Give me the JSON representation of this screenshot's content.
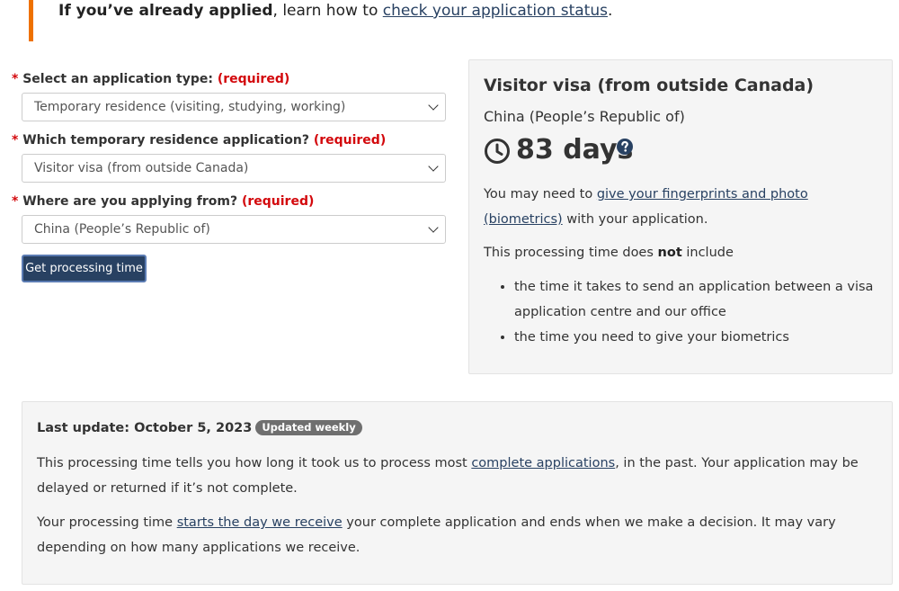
{
  "alert": {
    "bold": "If you’ve already applied",
    "text": ", learn how to ",
    "link": "check your application status",
    "end": "."
  },
  "form": {
    "required_star": "*",
    "required_text": "(required)",
    "fields": [
      {
        "label": "Select an application type:",
        "value": "Temporary residence (visiting, studying, working)"
      },
      {
        "label": "Which temporary residence application?",
        "value": "Visitor visa (from outside Canada)"
      },
      {
        "label": "Where are you applying from?",
        "value": "China (People’s Republic of)"
      }
    ],
    "submit_label": "Get processing time"
  },
  "result": {
    "title": "Visitor visa (from outside Canada)",
    "country": "China (People’s Republic of)",
    "days": "83 days",
    "biometrics_pre": "You may need to ",
    "biometrics_link": "give your fingerprints and photo (biometrics)",
    "biometrics_post": " with your application.",
    "exclude_pre": "This processing time does ",
    "exclude_bold": "not",
    "exclude_post": " include",
    "bullets": [
      "the time it takes to send an application between a visa application centre and our office",
      "the time you need to give your biometrics"
    ]
  },
  "info": {
    "last_update": "Last update: October 5, 2023",
    "badge": "Updated weekly",
    "p1_pre": "This processing time tells you how long it took us to process most ",
    "p1_link": "complete applications",
    "p1_post": ", in the past. Your application may be delayed or returned if it’s not complete.",
    "p2_pre": "Your processing time ",
    "p2_link": "starts the day we receive",
    "p2_post": " your complete application and ends when we make a decision. It may vary depending on how many applications we receive."
  },
  "colors": {
    "accent_orange": "#ee7100",
    "required_red": "#d3080c",
    "button_blue": "#284162",
    "link_blue": "#284162",
    "panel_bg": "#f5f5f5"
  },
  "icons": {
    "clock": "clock-icon",
    "help": "question-circle-icon",
    "dropdown": "chevron-down-icon"
  }
}
